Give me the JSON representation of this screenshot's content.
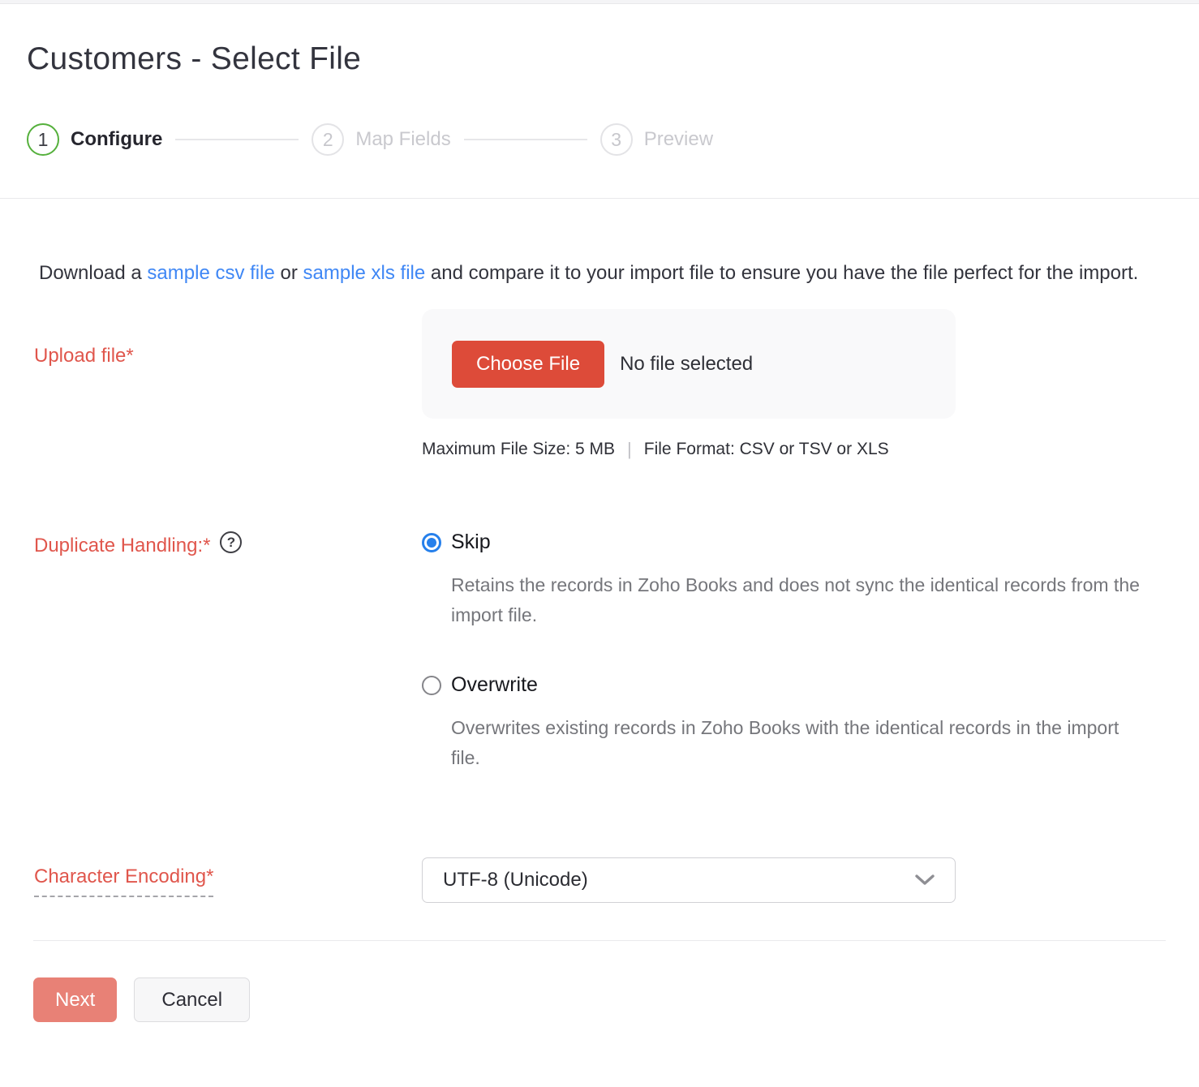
{
  "page": {
    "title": "Customers - Select File"
  },
  "stepper": {
    "steps": [
      {
        "number": "1",
        "label": "Configure",
        "state": "active"
      },
      {
        "number": "2",
        "label": "Map Fields",
        "state": "inactive"
      },
      {
        "number": "3",
        "label": "Preview",
        "state": "inactive"
      }
    ]
  },
  "intro": {
    "text_before": "Download a ",
    "link_csv": "sample csv file",
    "text_middle": " or ",
    "link_xls": "sample xls file",
    "text_after": " and compare it to your import file to ensure you have the file perfect for the import."
  },
  "upload": {
    "label": "Upload file*",
    "choose_button": "Choose File",
    "no_file_text": "No file selected",
    "max_size": "Maximum File Size: 5 MB",
    "separator": "|",
    "file_format": "File Format: CSV or TSV or XLS"
  },
  "duplicate_handling": {
    "label": "Duplicate Handling:*",
    "help_glyph": "?",
    "options": [
      {
        "label": "Skip",
        "description": "Retains the records in Zoho Books and does not sync the identical records from the import file.",
        "selected": true
      },
      {
        "label": "Overwrite",
        "description": "Overwrites existing records in Zoho Books with the identical records in the import file.",
        "selected": false
      }
    ]
  },
  "character_encoding": {
    "label": "Character Encoding*",
    "value": "UTF-8 (Unicode)"
  },
  "actions": {
    "next": "Next",
    "cancel": "Cancel"
  },
  "colors": {
    "accent_red": "#dd4b39",
    "label_red": "#e0564c",
    "link_blue": "#3f87f5",
    "radio_blue": "#2680eb",
    "step_green": "#55b03c",
    "next_salmon": "#e88176"
  }
}
